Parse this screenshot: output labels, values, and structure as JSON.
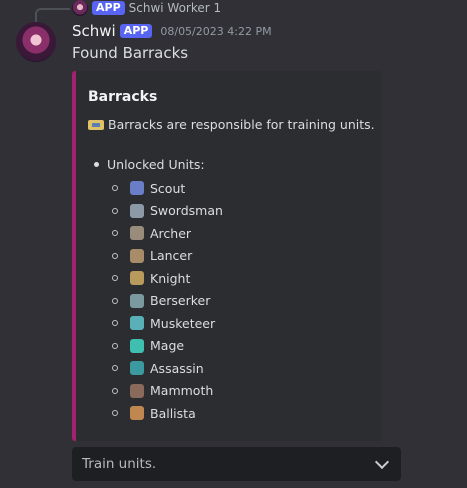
{
  "reply": {
    "app_tag": "APP",
    "author": "Schwi Worker 1"
  },
  "message": {
    "username": "Schwi",
    "app_tag": "APP",
    "timestamp": "08/05/2023 4:22 PM",
    "content": "Found Barracks"
  },
  "embed": {
    "accent_color": "#a3216f",
    "title": "Barracks",
    "description_icon": "ticket-icon",
    "description": "Barracks are responsible for training units.",
    "list_title": "Unlocked Units:",
    "units": [
      {
        "name": "Scout",
        "icon": "scout-icon",
        "color": "#6a7ec8"
      },
      {
        "name": "Swordsman",
        "icon": "swordsman-icon",
        "color": "#8c9aa8"
      },
      {
        "name": "Archer",
        "icon": "archer-icon",
        "color": "#9a8c7a"
      },
      {
        "name": "Lancer",
        "icon": "lancer-icon",
        "color": "#a88c6a"
      },
      {
        "name": "Knight",
        "icon": "knight-icon",
        "color": "#b89a5c"
      },
      {
        "name": "Berserker",
        "icon": "berserker-icon",
        "color": "#7a9aa0"
      },
      {
        "name": "Musketeer",
        "icon": "musketeer-icon",
        "color": "#5ab0b8"
      },
      {
        "name": "Mage",
        "icon": "mage-icon",
        "color": "#3fbfb0"
      },
      {
        "name": "Assassin",
        "icon": "assassin-icon",
        "color": "#3a9aa0"
      },
      {
        "name": "Mammoth",
        "icon": "mammoth-icon",
        "color": "#8a6a5a"
      },
      {
        "name": "Ballista",
        "icon": "ballista-icon",
        "color": "#c08850"
      }
    ]
  },
  "select": {
    "placeholder": "Train units."
  }
}
